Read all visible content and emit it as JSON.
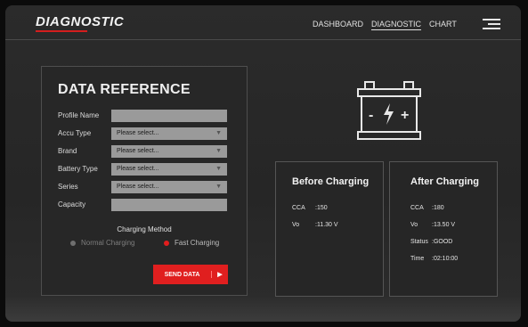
{
  "header": {
    "brand": "DIAGNOSTIC",
    "nav": [
      {
        "label": "DASHBOARD"
      },
      {
        "label": "DIAGNOSTIC"
      },
      {
        "label": "CHART"
      }
    ]
  },
  "reference": {
    "title": "DATA REFERENCE",
    "fields": [
      {
        "label": "Profile Name",
        "value": ""
      },
      {
        "label": "Accu Type",
        "value": "Please select..."
      },
      {
        "label": "Brand",
        "value": "Please select..."
      },
      {
        "label": "Battery Type",
        "value": "Please select..."
      },
      {
        "label": "Series",
        "value": "Please select..."
      },
      {
        "label": "Capacity",
        "value": ""
      }
    ],
    "charging_method_label": "Charging Method",
    "options": [
      "Normal Charging",
      "Fast Charging"
    ],
    "selected_option": "Fast Charging",
    "send_label": "SEND DATA"
  },
  "battery_icon": {
    "minus": "-",
    "plus": "+"
  },
  "before": {
    "title": "Before Charging",
    "rows": [
      {
        "label": "CCA",
        "value": ":150"
      },
      {
        "label": "Vo",
        "value": ":11.30 V"
      }
    ]
  },
  "after": {
    "title": "After Charging",
    "rows": [
      {
        "label": "CCA",
        "value": ":180"
      },
      {
        "label": "Vo",
        "value": ":13.50 V"
      },
      {
        "label": "Status",
        "value": ":GOOD"
      },
      {
        "label": "Time",
        "value": ":02:10:00"
      }
    ]
  },
  "colors": {
    "accent": "#e01f1f",
    "panel": "#272727",
    "field": "#9a9a9a"
  }
}
